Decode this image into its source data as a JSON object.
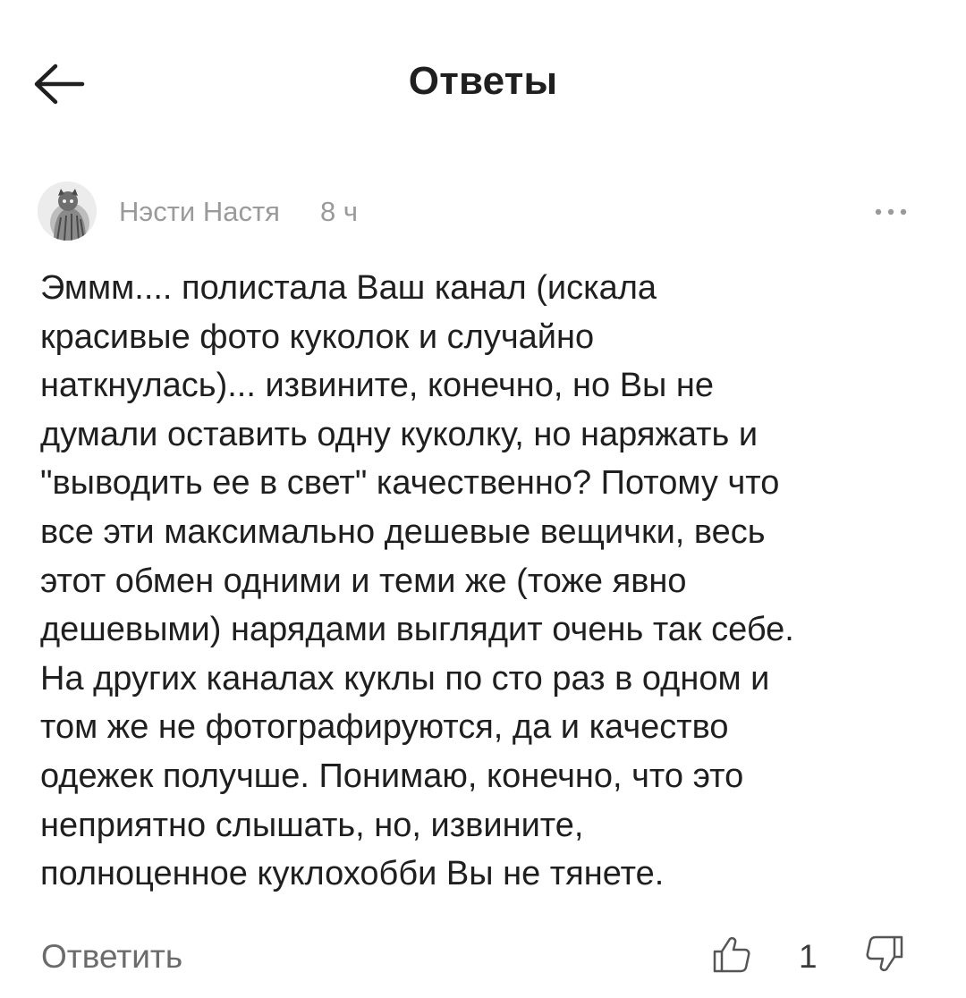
{
  "header": {
    "title": "Ответы",
    "back_icon": "arrow-left-icon"
  },
  "comment": {
    "author": "Нэсти Настя",
    "time": "8 ч",
    "more_icon": "more-horizontal-icon",
    "text": "Эммм.... полистала Ваш  канал (искала\nкрасивые фото куколок и случайно\nнаткнулась)... извините, конечно, но Вы не\nдумали оставить одну куколку, но наряжать и\n\"выводить ее в свет\" качественно? Потому что\nвсе эти максимально дешевые вещички, весь\nэтот обмен одними и теми же (тоже явно\nдешевыми) нарядами выглядит очень так себе.\nНа других каналах куклы по сто раз в одном и\nтом же не фотографируются, да и качество\nодежек получше. Понимаю, конечно, что это\nнеприятно слышать, но, извините,\nполноценное куклохобби Вы не тянете."
  },
  "actions": {
    "reply_label": "Ответить",
    "like_count": "1",
    "like_icon": "thumbs-up-icon",
    "dislike_icon": "thumbs-down-icon"
  }
}
